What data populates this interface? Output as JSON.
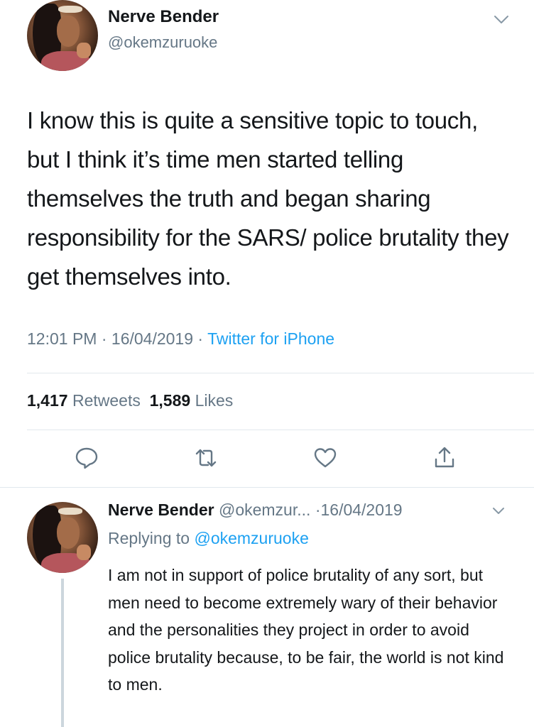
{
  "main_tweet": {
    "author_name": "Nerve Bender",
    "author_handle": "@okemzuruoke",
    "text": "I know this is quite a sensitive topic to touch, but I think it’s time men started telling themselves the truth and began sharing responsibility for the SARS/ police brutality they get themselves into.",
    "time": "12:01 PM",
    "date": "16/04/2019",
    "source": "Twitter for iPhone",
    "retweets_count": "1,417",
    "retweets_label": "Retweets",
    "likes_count": "1,589",
    "likes_label": "Likes",
    "actions": [
      "reply-icon",
      "retweet-icon",
      "like-icon",
      "share-icon"
    ]
  },
  "reply_tweet": {
    "author_name": "Nerve Bender",
    "author_handle": "@okemzur...",
    "date": "16/04/2019",
    "replying_prefix": "Replying to",
    "replying_to": "@okemzuruoke",
    "text": "I am not in support of police brutality of any sort, but men need to become extremely wary of their behavior and the personalities they project in order to avoid police brutality because, to be fair, the world is not kind to men."
  },
  "colors": {
    "text": "#14171a",
    "secondary": "#657786",
    "accent": "#1da1f2",
    "divider": "#e1e8ed",
    "thread_line": "#ccd6dd"
  }
}
